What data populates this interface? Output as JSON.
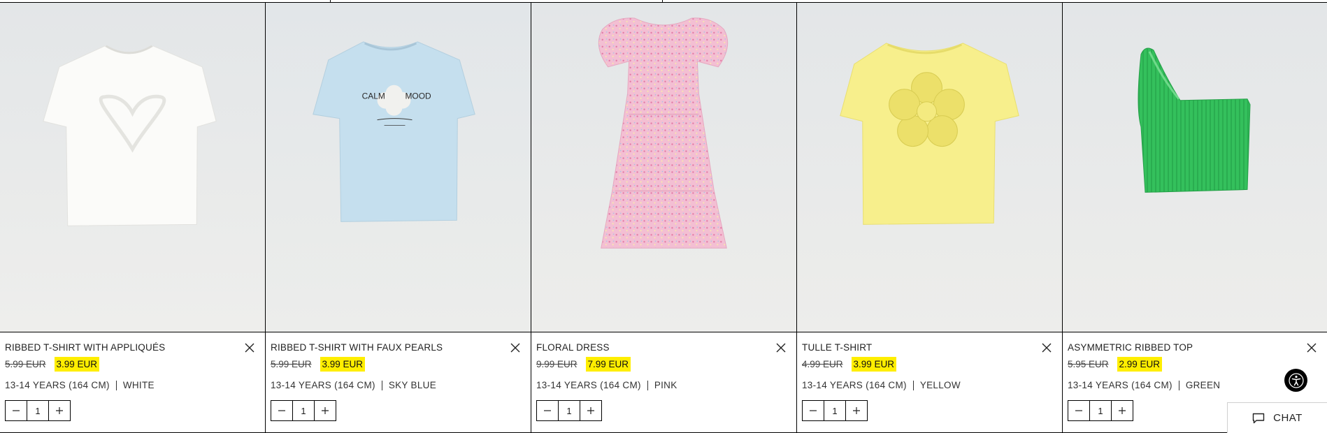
{
  "products": [
    {
      "name": "RIBBED T-SHIRT WITH APPLIQUÉS",
      "old_price": "5.99 EUR",
      "new_price": "3.99 EUR",
      "size": "13-14 YEARS (164 CM)",
      "color": "WHITE",
      "quantity": "1",
      "image_icon": "white-ribbed-tshirt-heart-image"
    },
    {
      "name": "RIBBED T-SHIRT WITH FAUX PEARLS",
      "old_price": "5.99 EUR",
      "new_price": "3.99 EUR",
      "size": "13-14 YEARS (164 CM)",
      "color": "SKY BLUE",
      "quantity": "1",
      "image_icon": "blue-tshirt-calm-mood-image",
      "print_left": "CALM",
      "print_right": "MOOD"
    },
    {
      "name": "FLORAL DRESS",
      "old_price": "9.99 EUR",
      "new_price": "7.99 EUR",
      "size": "13-14 YEARS (164 CM)",
      "color": "PINK",
      "quantity": "1",
      "image_icon": "pink-floral-dress-image"
    },
    {
      "name": "TULLE T-SHIRT",
      "old_price": "4.99 EUR",
      "new_price": "3.99 EUR",
      "size": "13-14 YEARS (164 CM)",
      "color": "YELLOW",
      "quantity": "1",
      "image_icon": "yellow-tulle-tshirt-image"
    },
    {
      "name": "ASYMMETRIC RIBBED TOP",
      "old_price": "5.95 EUR",
      "new_price": "2.99 EUR",
      "size": "13-14 YEARS (164 CM)",
      "color": "GREEN",
      "quantity": "1",
      "image_icon": "green-asymmetric-top-image"
    }
  ],
  "chat": {
    "label": "CHAT",
    "icon": "chat-bubble-icon"
  },
  "accessibility": {
    "icon": "accessibility-icon"
  },
  "colors": {
    "price_highlight": "#ffee00",
    "border": "#000000",
    "image_bg": "#e8eaeb"
  }
}
